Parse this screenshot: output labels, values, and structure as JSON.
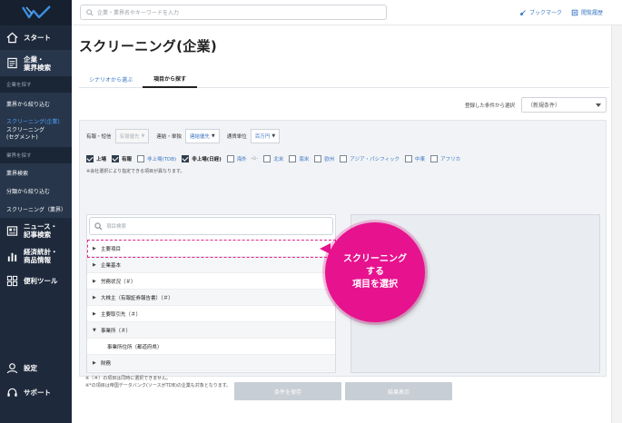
{
  "colors": {
    "sidebar": "#1e2a3c",
    "accent": "#3a76c4",
    "highlight": "#e2258a",
    "bubble": "#e7128e"
  },
  "header": {
    "search_placeholder": "企業・業界名やキーワードを入力",
    "bookmark": "ブックマーク",
    "history": "閲覧履歴"
  },
  "sidebar": {
    "start": "スタート",
    "company": {
      "line1": "企業・",
      "line2": "業界検索"
    },
    "section_company": "企業を探す",
    "industry_narrow": "業界から絞り込む",
    "screening_company": "スクリーニング(企業)",
    "screening_segment": {
      "line1": "スクリーニング",
      "line2": "(セグメント)"
    },
    "section_industry": "業界を探す",
    "industry_search": "業界検索",
    "category_narrow": "分類から絞り込む",
    "screening_industry": "スクリーニング（業界）",
    "news": {
      "line1": "ニュース・",
      "line2": "記事検索"
    },
    "economy": {
      "line1": "経済統計・",
      "line2": "商品情報"
    },
    "tools": "便利ツール",
    "settings": "設定",
    "support": "サポート"
  },
  "page": {
    "title": "スクリーニング(企業)",
    "tabs": [
      {
        "label": "シナリオから選ぶ",
        "active": false
      },
      {
        "label": "項目から探す",
        "active": true
      }
    ],
    "saved_label": "登録した条件から選択",
    "saved_value": "（新規条件）"
  },
  "filters": {
    "period_label": "有報・短信",
    "period_value": "有報優先",
    "consol_label": "連結・単独",
    "consol_value": "連結優先",
    "currency_label": "通貨単位",
    "currency_value": "百万円",
    "arrow": "▼"
  },
  "markets": [
    {
      "label": "上場",
      "checked": true
    },
    {
      "label": "有報",
      "checked": true
    },
    {
      "label": "非上場(TDB)",
      "checked": false
    },
    {
      "label": "非上場(日経)",
      "checked": true
    },
    {
      "label": "海外",
      "checked": false
    },
    {
      "label": "北米",
      "checked": false
    },
    {
      "label": "南米",
      "checked": false
    },
    {
      "label": "欧州",
      "checked": false
    },
    {
      "label": "アジア・パシフィック",
      "checked": false
    },
    {
      "label": "中東",
      "checked": false
    },
    {
      "label": "アフリカ",
      "checked": false
    }
  ],
  "note1": "※会社選択により指定できる項目が異なります。",
  "list": {
    "search_placeholder": "項目検索",
    "items": [
      {
        "label": "主要項目",
        "marker": "▶"
      },
      {
        "label": "企業基本",
        "marker": "▶"
      },
      {
        "label": "労務状況（＃）",
        "marker": "▶"
      },
      {
        "label": "大株主（有報証券報告書）（＃）",
        "marker": "▶"
      },
      {
        "label": "主要取引先（＃）",
        "marker": "▶"
      },
      {
        "label": "事業所（＃）",
        "marker": "▼"
      },
      {
        "label": "事業所住所（都道府県）",
        "marker": ""
      },
      {
        "label": "財務",
        "marker": "▶"
      }
    ]
  },
  "bubble": {
    "line1": "スクリーニング",
    "line2": "する",
    "line3": "項目を選択"
  },
  "notes": {
    "line1": "※（＃）の項目は同時に選択できません。",
    "line2": "※*の項目は帝国データバンク(ソースがTDB)の企業も対象となります。"
  },
  "buttons": {
    "save": "条件を保存",
    "show": "結果表示"
  }
}
